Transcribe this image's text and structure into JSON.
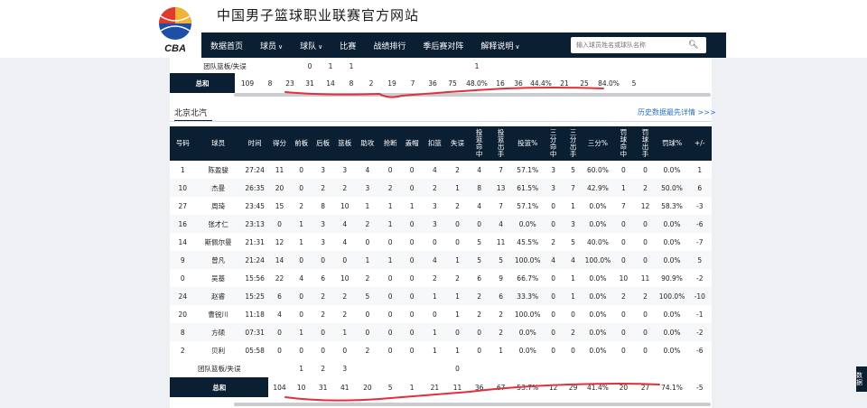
{
  "site": {
    "title": "中国男子篮球职业联赛官方网站",
    "logo_text": "CBA",
    "logo_colors": [
      "#e03a2f",
      "#1d4fa8",
      "#f2b233"
    ]
  },
  "nav": {
    "items": [
      {
        "label": "数据首页",
        "dropdown": false
      },
      {
        "label": "球员",
        "dropdown": true
      },
      {
        "label": "球队",
        "dropdown": true
      },
      {
        "label": "比赛",
        "dropdown": false
      },
      {
        "label": "战绩排行",
        "dropdown": false
      },
      {
        "label": "季后赛对阵",
        "dropdown": false
      },
      {
        "label": "解释说明",
        "dropdown": true
      }
    ],
    "search_placeholder": "输入球员姓名或球队名称"
  },
  "upper_table": {
    "team_row": {
      "label": "团队篮板/失误",
      "values": [
        "",
        "",
        "",
        "0",
        "1",
        "1",
        "",
        "",
        "",
        "",
        "",
        "1",
        "",
        "",
        "",
        "",
        "",
        "",
        "",
        "",
        "",
        "",
        ""
      ]
    },
    "total_row": {
      "label": "总和",
      "values": [
        "",
        "109",
        "8",
        "23",
        "31",
        "14",
        "8",
        "2",
        "19",
        "7",
        "36",
        "75",
        "48.0%",
        "16",
        "36",
        "44.4%",
        "21",
        "25",
        "84.0%",
        "5"
      ]
    }
  },
  "team": {
    "name": "北京北汽",
    "history_link": "历史数据最先详情 >>>"
  },
  "columns": [
    "号码",
    "球员",
    "时间",
    "得分",
    "前板",
    "后板",
    "篮板",
    "助攻",
    "抢断",
    "盖帽",
    "扣篮",
    "失误",
    "投篮命中",
    "投篮出手",
    "投篮%",
    "三分命中",
    "三分出手",
    "三分%",
    "罚球命中",
    "罚球出手",
    "罚球%",
    "+/-"
  ],
  "players": [
    [
      "1",
      "陈盈骏",
      "27:24",
      "11",
      "0",
      "3",
      "3",
      "4",
      "0",
      "0",
      "4",
      "2",
      "4",
      "7",
      "57.1%",
      "3",
      "5",
      "60.0%",
      "0",
      "0",
      "0.0%",
      "1"
    ],
    [
      "10",
      "杰曼",
      "26:35",
      "20",
      "0",
      "2",
      "2",
      "3",
      "2",
      "0",
      "2",
      "1",
      "8",
      "13",
      "61.5%",
      "3",
      "7",
      "42.9%",
      "1",
      "2",
      "50.0%",
      "6"
    ],
    [
      "27",
      "周琦",
      "23:45",
      "15",
      "2",
      "8",
      "10",
      "1",
      "1",
      "1",
      "3",
      "2",
      "4",
      "7",
      "57.1%",
      "0",
      "1",
      "0.0%",
      "7",
      "12",
      "58.3%",
      "-3"
    ],
    [
      "16",
      "张才仁",
      "23:13",
      "0",
      "1",
      "3",
      "4",
      "2",
      "1",
      "0",
      "3",
      "0",
      "0",
      "4",
      "0.0%",
      "0",
      "3",
      "0.0%",
      "0",
      "0",
      "0.0%",
      "-6"
    ],
    [
      "14",
      "斯佩尔曼",
      "21:31",
      "12",
      "1",
      "3",
      "4",
      "0",
      "0",
      "0",
      "0",
      "0",
      "5",
      "11",
      "45.5%",
      "2",
      "5",
      "40.0%",
      "0",
      "0",
      "0.0%",
      "-7"
    ],
    [
      "9",
      "曾凡",
      "21:24",
      "14",
      "0",
      "0",
      "0",
      "1",
      "1",
      "0",
      "4",
      "1",
      "5",
      "5",
      "100.0%",
      "4",
      "4",
      "100.0%",
      "0",
      "0",
      "0.0%",
      "5"
    ],
    [
      "0",
      "吴基",
      "15:56",
      "22",
      "4",
      "6",
      "10",
      "2",
      "0",
      "0",
      "2",
      "2",
      "6",
      "9",
      "66.7%",
      "0",
      "1",
      "0.0%",
      "10",
      "11",
      "90.9%",
      "-2"
    ],
    [
      "24",
      "赵睿",
      "15:25",
      "6",
      "0",
      "2",
      "2",
      "5",
      "0",
      "0",
      "1",
      "1",
      "2",
      "6",
      "33.3%",
      "0",
      "1",
      "0.0%",
      "2",
      "2",
      "100.0%",
      "-10"
    ],
    [
      "20",
      "曹锐川",
      "11:18",
      "4",
      "0",
      "2",
      "2",
      "0",
      "0",
      "0",
      "0",
      "1",
      "2",
      "2",
      "100.0%",
      "0",
      "0",
      "0.0%",
      "0",
      "0",
      "0.0%",
      "-1"
    ],
    [
      "8",
      "方硕",
      "07:31",
      "0",
      "1",
      "0",
      "1",
      "0",
      "0",
      "0",
      "1",
      "0",
      "0",
      "2",
      "0.0%",
      "0",
      "2",
      "0.0%",
      "0",
      "0",
      "0.0%",
      "-2"
    ],
    [
      "2",
      "贝利",
      "05:58",
      "0",
      "0",
      "0",
      "0",
      "2",
      "0",
      "0",
      "1",
      "1",
      "0",
      "1",
      "0.0%",
      "0",
      "0",
      "0.0%",
      "0",
      "0",
      "0.0%",
      "-6"
    ]
  ],
  "lower_team_row": {
    "label": "团队篮板/失误",
    "values": [
      "",
      "",
      "",
      "",
      "1",
      "2",
      "3",
      "",
      "",
      "",
      "",
      "0",
      "",
      "",
      "",
      "",
      "",
      "",
      "",
      "",
      "",
      ""
    ]
  },
  "lower_total_row": {
    "label": "总和",
    "values": [
      "",
      "104",
      "10",
      "31",
      "41",
      "20",
      "5",
      "1",
      "21",
      "11",
      "36",
      "67",
      "53.7%",
      "12",
      "29",
      "41.4%",
      "20",
      "27",
      "74.1%",
      "-5"
    ]
  },
  "side_tab": {
    "label": "数据"
  },
  "annotation_color": "#e0303a"
}
